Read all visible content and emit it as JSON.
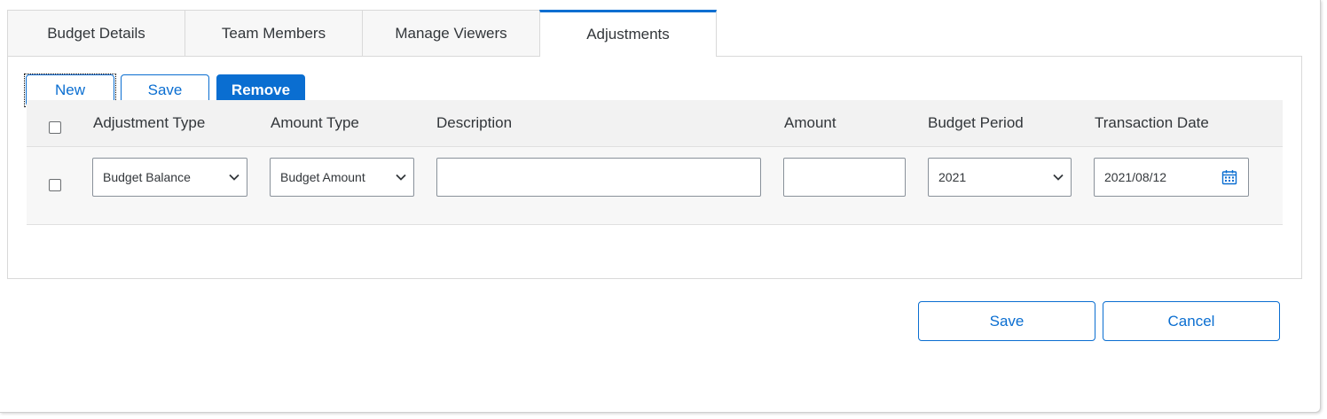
{
  "tabs": [
    {
      "label": "Budget Details"
    },
    {
      "label": "Team Members"
    },
    {
      "label": "Manage Viewers"
    },
    {
      "label": "Adjustments",
      "active": true
    }
  ],
  "toolbar": {
    "new_label": "New",
    "save_label": "Save",
    "remove_label": "Remove"
  },
  "table": {
    "columns": [
      "Adjustment Type",
      "Amount Type",
      "Description",
      "Amount",
      "Budget Period",
      "Transaction Date"
    ],
    "rows": [
      {
        "adjustment_type": "Budget Balance",
        "amount_type": "Budget Amount",
        "description": "",
        "amount": "",
        "budget_period": "2021",
        "transaction_date": "2021/08/12"
      }
    ]
  },
  "footer": {
    "save_label": "Save",
    "cancel_label": "Cancel"
  },
  "colors": {
    "accent": "#0a6ed1",
    "text": "#32363a",
    "header_bg": "#f2f2f2"
  },
  "icons": {
    "dropdown": "chevron-down-icon",
    "date_picker": "calendar-icon"
  }
}
